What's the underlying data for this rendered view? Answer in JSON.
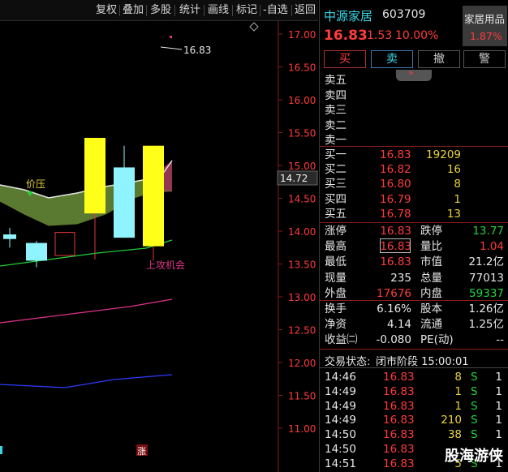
{
  "toolbar": {
    "items": [
      "复权",
      "叠加",
      "多股",
      "统计",
      "画线",
      "标记",
      "-自选",
      "返回"
    ]
  },
  "chart": {
    "price_axis": [
      "17.00",
      "16.50",
      "16.00",
      "15.50",
      "15.00",
      "14.50",
      "14.00",
      "13.50",
      "13.00",
      "12.50",
      "12.00",
      "11.50",
      "11.00"
    ],
    "current_price_label": "14.72",
    "high_marker": "16.83",
    "annotation_pressure": "价压",
    "annotation_attack": "上攻机会",
    "limit_up_tag": "涨",
    "candles": [
      {
        "o": 13.95,
        "h": 14.05,
        "l": 13.75,
        "c": 13.88,
        "color": "cyan"
      },
      {
        "o": 13.55,
        "h": 13.85,
        "l": 13.45,
        "c": 13.82,
        "color": "cyan"
      },
      {
        "o": 13.63,
        "h": 13.98,
        "l": 13.63,
        "c": 13.98,
        "color": "red_hollow"
      },
      {
        "o": 14.27,
        "h": 15.42,
        "l": 13.57,
        "c": 15.42,
        "color": "yellow"
      },
      {
        "o": 13.9,
        "h": 15.3,
        "l": 13.9,
        "c": 14.97,
        "color": "cyan"
      },
      {
        "o": 13.77,
        "h": 15.3,
        "l": 13.55,
        "c": 15.3,
        "color": "yellow"
      }
    ]
  },
  "quote": {
    "name": "中源家居",
    "code": "603709",
    "sector": "家居用品",
    "sector_change": "1.87%",
    "price": "16.83",
    "change": "1.53",
    "change_pct": "10.00%",
    "buttons": [
      "买",
      "卖",
      "撤",
      "警"
    ],
    "sell_levels": [
      {
        "label": "卖五",
        "price": "",
        "vol": ""
      },
      {
        "label": "卖四",
        "price": "",
        "vol": ""
      },
      {
        "label": "卖三",
        "price": "",
        "vol": ""
      },
      {
        "label": "卖二",
        "price": "",
        "vol": ""
      },
      {
        "label": "卖一",
        "price": "",
        "vol": ""
      }
    ],
    "buy_levels": [
      {
        "label": "买一",
        "price": "16.83",
        "vol": "19209"
      },
      {
        "label": "买二",
        "price": "16.82",
        "vol": "16"
      },
      {
        "label": "买三",
        "price": "16.80",
        "vol": "8"
      },
      {
        "label": "买四",
        "price": "16.79",
        "vol": "1"
      },
      {
        "label": "买五",
        "price": "16.78",
        "vol": "13"
      }
    ],
    "stats": [
      {
        "l1": "涨停",
        "v1": "16.83",
        "c1": "red",
        "l2": "跌停",
        "v2": "13.77",
        "c2": "green"
      },
      {
        "l1": "最高",
        "v1": "16.83",
        "c1": "red",
        "l2": "量比",
        "v2": "1.04",
        "c2": "red"
      },
      {
        "l1": "最低",
        "v1": "16.83",
        "c1": "red",
        "l2": "市值",
        "v2": "21.2亿",
        "c2": "white"
      },
      {
        "l1": "现量",
        "v1": "235",
        "c1": "white",
        "l2": "总量",
        "v2": "77013",
        "c2": "white"
      },
      {
        "l1": "外盘",
        "v1": "17676",
        "c1": "red",
        "l2": "内盘",
        "v2": "59337",
        "c2": "green"
      }
    ],
    "stats2": [
      {
        "l1": "换手",
        "v1": "6.16%",
        "c1": "white",
        "l2": "股本",
        "v2": "1.26亿",
        "c2": "white"
      },
      {
        "l1": "净资",
        "v1": "4.14",
        "c1": "white",
        "l2": "流通",
        "v2": "1.25亿",
        "c2": "white"
      },
      {
        "l1": "收益㈡",
        "v1": "-0.080",
        "c1": "white",
        "l2": "PE(动)",
        "v2": "--",
        "c2": "white"
      }
    ],
    "trade_status_label": "交易状态:",
    "trade_status": "闭市阶段 15:00:01",
    "ticks": [
      {
        "time": "14:46",
        "price": "16.83",
        "vol": "8",
        "side": "S",
        "n": "1"
      },
      {
        "time": "14:49",
        "price": "16.83",
        "vol": "1",
        "side": "S",
        "n": "1"
      },
      {
        "time": "14:49",
        "price": "16.83",
        "vol": "1",
        "side": "S",
        "n": "1"
      },
      {
        "time": "14:49",
        "price": "16.83",
        "vol": "210",
        "side": "S",
        "n": "1"
      },
      {
        "time": "14:50",
        "price": "16.83",
        "vol": "38",
        "side": "S",
        "n": "1"
      },
      {
        "time": "14:50",
        "price": "16.83",
        "vol": "",
        "side": "",
        "n": ""
      },
      {
        "time": "14:51",
        "price": "16.83",
        "vol": "5",
        "side": "S",
        "n": "1"
      }
    ]
  },
  "watermark": "股海游侠"
}
